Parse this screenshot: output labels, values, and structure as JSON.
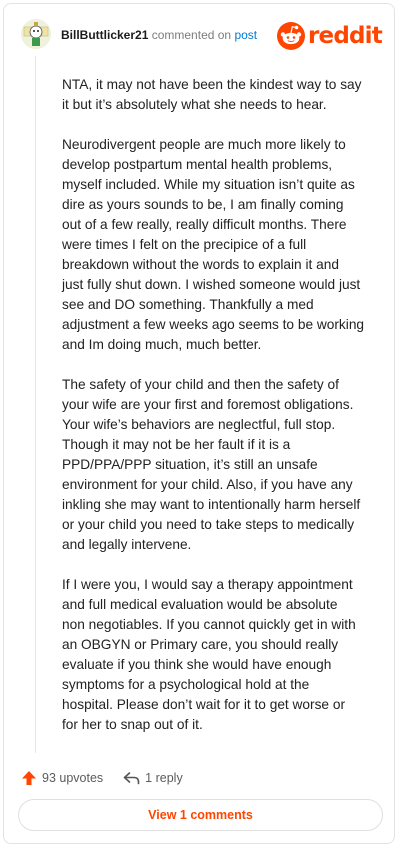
{
  "header": {
    "username": "BillButtlicker21",
    "commented_text": "commented on",
    "post_link": "post",
    "logo_text": "reddit",
    "brand_color": "#ff4500"
  },
  "comment": {
    "paragraphs": [
      "NTA, it may not have been the kindest way to say\nit but it’s absolutely what she needs to hear.",
      "Neurodivergent people are much more likely to\ndevelop postpartum mental health problems,\nmyself included. While my situation isn’t quite as\ndire as yours sounds to be, I am finally coming\nout of a few really, really difficult months. There\nwere times I felt on the precipice of a full\nbreakdown without the words to explain it and\njust fully shut down. I wished someone would just\nsee and DO something. Thankfully a med\nadjustment a few weeks ago seems to be working\nand Im doing much, much better.",
      "The safety of your child and then the safety of\nyour wife are your first and foremost obligations.\nYour wife’s behaviors are neglectful, full stop.\nThough it may not be her fault if it is a\nPPD/PPA/PPP situation, it’s still an unsafe\nenvironment for your child. Also, if you have any\ninkling she may want to intentionally harm herself\nor your child you need to take steps to medically\nand legally intervene.",
      "If I were you, I would say a therapy appointment\nand full medical evaluation would be absolute\nnon negotiables. If you cannot quickly get in with\nan OBGYN or Primary care, you should really\nevaluate if you think she would have enough\nsymptoms for a psychological hold at the\nhospital. Please don’t wait for it to get worse or\nfor her to snap out of it."
    ]
  },
  "actions": {
    "upvotes": "93 upvotes",
    "replies": "1 reply",
    "upvote_icon": "upvote-arrow-icon",
    "reply_icon": "reply-arrow-icon"
  },
  "footer": {
    "view_button": "View 1 comments"
  }
}
